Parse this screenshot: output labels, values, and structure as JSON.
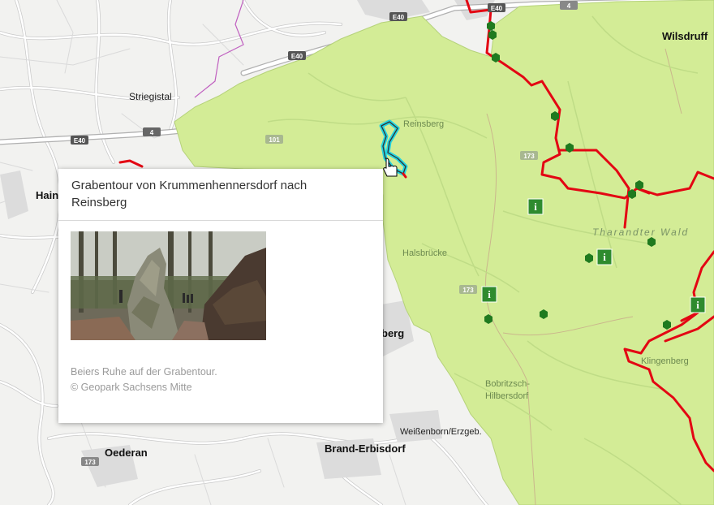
{
  "map": {
    "places": {
      "wilsdruff": "Wilsdruff",
      "striegistal": "Striegistal",
      "reinsberg": "Reinsberg",
      "hainichen": "Hain",
      "halsbruecke": "Halsbrücke",
      "freiberg": "berg",
      "tharandter_wald": "Tharandter Wald",
      "klingenberg": "Klingenberg",
      "bobritzsch": "Bobritzsch-",
      "hilbersdorf": "Hilbersdorf",
      "weissenborn": "Weißenborn/Erzgeb.",
      "oederan": "Oederan",
      "brand_erbisdorf": "Brand-Erbisdorf"
    },
    "roads": {
      "e40_east": "E40",
      "e40_center": "E40",
      "e40_mid": "E40",
      "e40_west": "E40",
      "a4_east": "4",
      "a4_west": "4",
      "b101": "101",
      "b173_north": "173",
      "b173_mid": "173",
      "b173_southwest": "173"
    },
    "colors": {
      "park_area": "#d3ec96",
      "trail": "#e30613",
      "selected_route": "#22d3e0",
      "poi_marker": "#1f7a1f",
      "info_marker": "#2e8b2e"
    }
  },
  "popup": {
    "title": "Grabentour von Krummenhennersdorf nach Reinsberg",
    "photo_alt": "Beiers Ruhe auf der Grabentour",
    "caption_line1": "Beiers Ruhe auf der Grabentour.",
    "caption_line2": "© Geopark Sachsens Mitte"
  }
}
